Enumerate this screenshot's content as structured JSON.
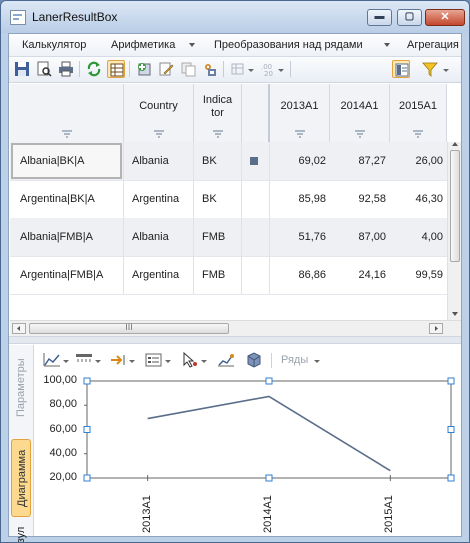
{
  "window": {
    "title": "LanerResultBox",
    "controls": {
      "minimize": "▬",
      "maximize": "▢",
      "close": "✕"
    }
  },
  "menu": {
    "items": [
      "Калькулятор",
      "Арифметика",
      "Преобразования над рядами",
      "Агрегация"
    ]
  },
  "toolbar": {
    "icons": [
      "save-icon",
      "print-preview-icon",
      "print-icon",
      "refresh-icon",
      "table-view-icon",
      "add-icon",
      "edit-icon",
      "copy-icon",
      "settings-icon",
      "chart-type-icon",
      "number-format-icon",
      "grid-icon",
      "filter-icon"
    ]
  },
  "grid": {
    "columns": [
      {
        "label": ""
      },
      {
        "label": "Country"
      },
      {
        "label": "Indica\ntor"
      },
      {
        "label": ""
      },
      {
        "label": "2013A1"
      },
      {
        "label": "2014A1"
      },
      {
        "label": "2015A1"
      }
    ],
    "rows": [
      {
        "name": "Albania|BK|A",
        "country": "Albania",
        "indicator": "BK",
        "marker": true,
        "v2013": "69,02",
        "v2014": "87,27",
        "v2015": "26,00"
      },
      {
        "name": "Argentina|BK|A",
        "country": "Argentina",
        "indicator": "BK",
        "marker": false,
        "v2013": "85,98",
        "v2014": "92,58",
        "v2015": "46,30"
      },
      {
        "name": "Albania|FMB|A",
        "country": "Albania",
        "indicator": "FMB",
        "marker": false,
        "v2013": "51,76",
        "v2014": "87,00",
        "v2015": "4,00"
      },
      {
        "name": "Argentina|FMB|A",
        "country": "Argentina",
        "indicator": "FMB",
        "marker": false,
        "v2013": "86,86",
        "v2014": "24,16",
        "v2015": "99,59"
      }
    ],
    "hscroll_grip": "III"
  },
  "side_tabs": {
    "params": "Параметры",
    "chart": "Диаграмма",
    "result": "Резул"
  },
  "chart_toolbar": {
    "series_label": "Ряды"
  },
  "chart_data": {
    "type": "line",
    "categories": [
      "2013A1",
      "2014A1",
      "2015A1"
    ],
    "series": [
      {
        "values": [
          69.02,
          87.27,
          26.0
        ]
      }
    ],
    "y_ticks": [
      "100,00",
      "80,00",
      "60,00",
      "40,00",
      "20,00"
    ],
    "ylim": [
      20,
      100
    ],
    "line_color": "#5a6d89"
  }
}
